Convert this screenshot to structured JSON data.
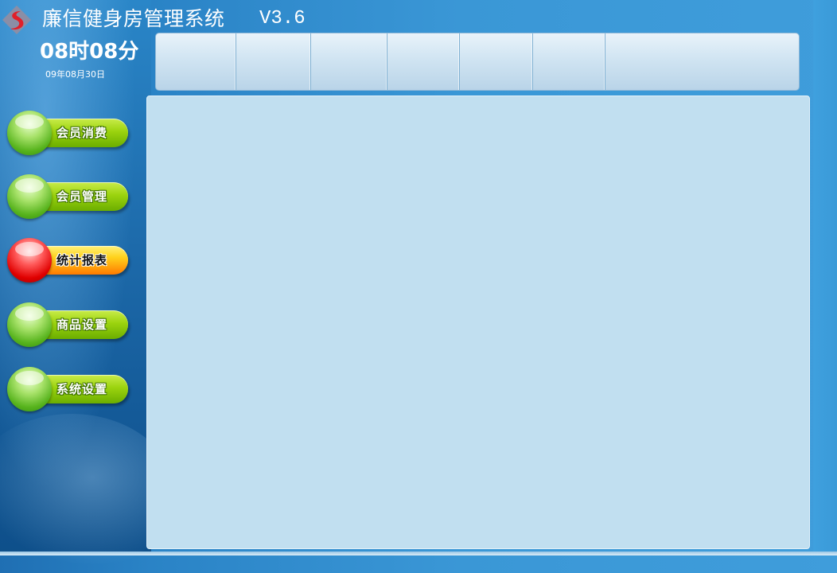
{
  "header": {
    "logo_icon": "swirl-logo-icon",
    "title": "廉信健身房管理系统",
    "version": "V3.6"
  },
  "clock": {
    "time": "08时08分",
    "date": "09年08月30日"
  },
  "nav": {
    "items": [
      {
        "label": "会员消费",
        "active": false
      },
      {
        "label": "会员管理",
        "active": false
      },
      {
        "label": "统计报表",
        "active": true
      },
      {
        "label": "商品设置",
        "active": false
      },
      {
        "label": "系统设置",
        "active": false
      }
    ]
  },
  "colors": {
    "accent_green": "#9bd30e",
    "active_red": "#e00000",
    "panel_bg": "#c1dff0",
    "background_blue": "#2a83c6"
  }
}
